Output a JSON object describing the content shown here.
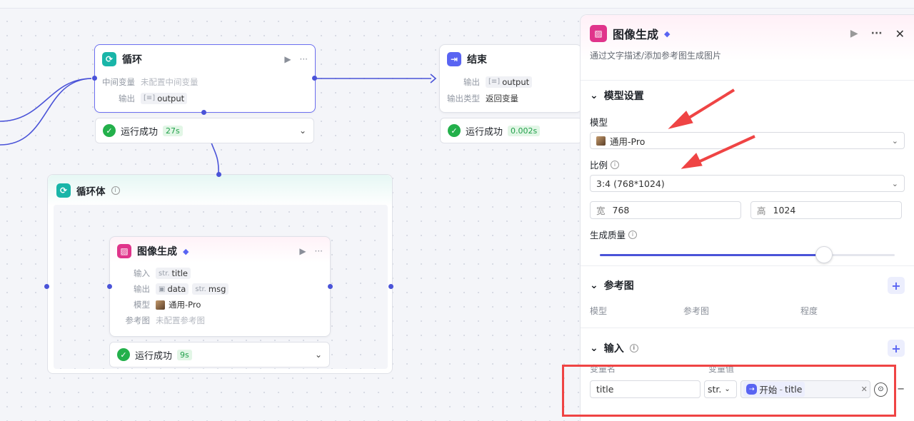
{
  "loop_node": {
    "title": "循环",
    "rows": [
      {
        "label": "中间变量",
        "value": "未配置中间变量"
      },
      {
        "label": "输出",
        "tag": "output"
      }
    ],
    "status": "运行成功",
    "duration": "27s"
  },
  "end_node": {
    "title": "结束",
    "rows": [
      {
        "label": "输出",
        "tag": "output"
      },
      {
        "label": "输出类型",
        "value": "返回变量"
      }
    ],
    "status": "运行成功",
    "duration": "0.002s"
  },
  "loop_body": {
    "title": "循环体"
  },
  "img_node": {
    "title": "图像生成",
    "input_label": "输入",
    "input_tag_type": "str.",
    "input_tag": "title",
    "output_label": "输出",
    "output_tag1": "data",
    "output_tag2_type": "str.",
    "output_tag2": "msg",
    "model_label": "模型",
    "model_value": "通用-Pro",
    "ref_label": "参考图",
    "ref_value": "未配置参考图",
    "status": "运行成功",
    "duration": "9s"
  },
  "panel": {
    "title": "图像生成",
    "description": "通过文字描述/添加参考图生成图片",
    "model_section": "模型设置",
    "model_label": "模型",
    "model_value": "通用-Pro",
    "ratio_label": "比例",
    "ratio_value": "3:4 (768*1024)",
    "width_label": "宽",
    "width_value": "768",
    "height_label": "高",
    "height_value": "1024",
    "quality_label": "生成质量",
    "quality_fraction": 0.76,
    "ref_section": "参考图",
    "ref_cols": [
      "模型",
      "参考图",
      "程度"
    ],
    "input_section": "输入",
    "input_cols": [
      "变量名",
      "变量值"
    ],
    "input_name": "title",
    "input_type": "str.",
    "input_ref_source": "开始",
    "input_ref_sep": "-",
    "input_ref_var": "title"
  },
  "colors": {
    "accent": "#5964f2",
    "success": "#23b04b",
    "highlight": "#ef4444"
  }
}
